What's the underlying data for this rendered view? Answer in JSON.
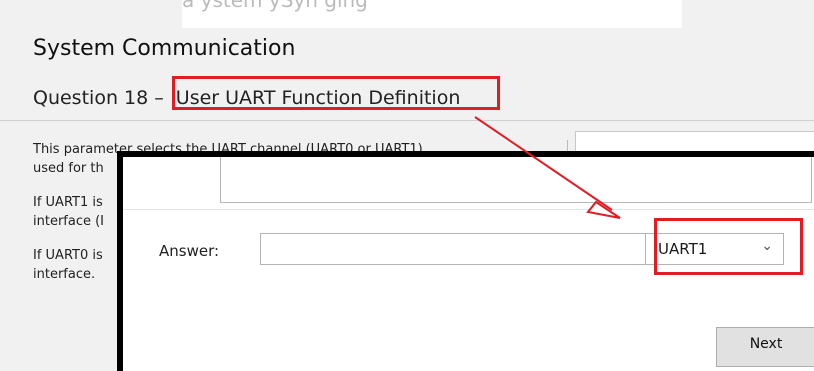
{
  "top_text": "a ystem ySyn ging",
  "header": {
    "title": "System Communication",
    "question_number": "Question 18 –",
    "question_title": "User UART Function Definition"
  },
  "description": {
    "line1": "This parameter selects the UART channel (UART0 or  UART1)",
    "line2": "used for th",
    "line3": "If UART1 is",
    "line4": "interface (I",
    "line5": "If UART0 is",
    "line6": "interface."
  },
  "answer": {
    "label": "Answer:",
    "input_value": "",
    "selected_option": "UART1"
  },
  "footer": {
    "next_label": "Next"
  },
  "colors": {
    "highlight": "#e31b23",
    "background": "#f1f1f1"
  },
  "icons": {
    "dropdown": "chevron-down-icon",
    "annotation_arrow": "arrow-icon"
  }
}
